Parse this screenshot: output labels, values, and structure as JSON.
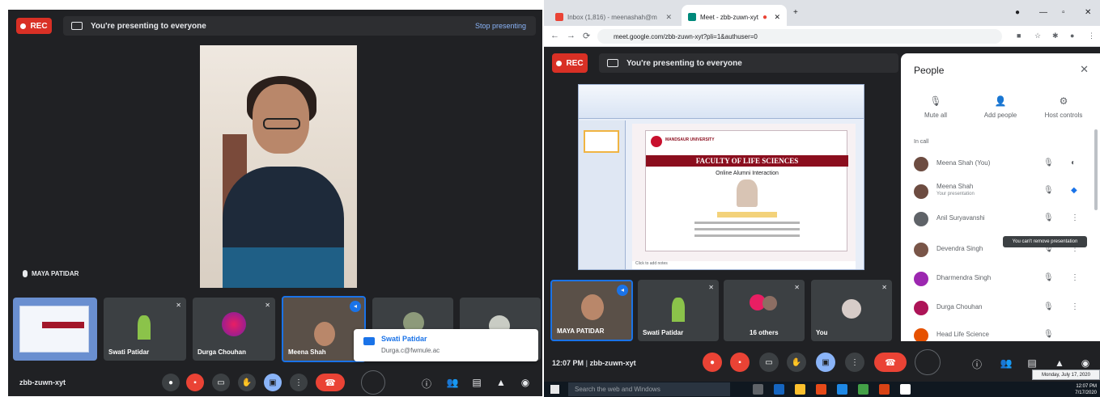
{
  "left": {
    "rec_label": "REC",
    "banner_text": "You're presenting to everyone",
    "stop_presenting": "Stop presenting",
    "main_speaker_name": "MAYA PATIDAR",
    "tiles": [
      {
        "name": ""
      },
      {
        "name": "Swati Patidar"
      },
      {
        "name": "Durga Chouhan"
      },
      {
        "name": "Meena Shah"
      },
      {
        "name": ""
      },
      {
        "name": ""
      }
    ],
    "popup_title": "Swati Patidar",
    "popup_sub": "Durga.c@fwmule.ac",
    "meeting_code": "zbb-zuwn-xyt"
  },
  "right": {
    "tabs": [
      {
        "label": "Inbox (1,816) - meenashah@m"
      },
      {
        "label": "Meet - zbb-zuwn-xyt"
      }
    ],
    "url": "meet.google.com/zbb-zuwn-xyt?pli=1&authuser=0",
    "rec_label": "REC",
    "banner_text": "You're presenting to everyone",
    "slide": {
      "title": "FACULTY OF LIFE SCIENCES",
      "subtitle": "Online Alumni Interaction",
      "logo_text": "MANDSAUR UNIVERSITY",
      "notes": "Click to add notes"
    },
    "tiles": [
      {
        "name": "MAYA PATIDAR"
      },
      {
        "name": "Swati Patidar"
      },
      {
        "name": "16 others"
      },
      {
        "name": "You"
      }
    ],
    "meeting_time": "12:07 PM",
    "meeting_code": "zbb-zuwn-xyt",
    "people": {
      "title": "People",
      "actions": [
        {
          "label": "Mute all"
        },
        {
          "label": "Add people"
        },
        {
          "label": "Host controls"
        }
      ],
      "in_call": "In call",
      "rows": [
        {
          "name": "Meena Shah (You)",
          "sub": "",
          "color": "#6d4c41"
        },
        {
          "name": "Meena Shah",
          "sub": "Your presentation",
          "color": "#6d4c41"
        },
        {
          "name": "Anil Suryavanshi",
          "sub": "",
          "color": "#5f6368"
        },
        {
          "name": "Devendra Singh",
          "sub": "",
          "color": "#795548"
        },
        {
          "name": "Dharmendra Singh",
          "sub": "",
          "color": "#9c27b0"
        },
        {
          "name": "Durga Chouhan",
          "sub": "",
          "color": "#ad1457"
        },
        {
          "name": "Head Life Science",
          "sub": "",
          "color": "#e65100"
        }
      ],
      "tooltip": "You can't remove presentation"
    },
    "taskbar_search": "Search the web and Windows",
    "clock_time": "12:07 PM",
    "clock_date": "7/17/2020",
    "date_tip": "Monday, July 17, 2020"
  }
}
